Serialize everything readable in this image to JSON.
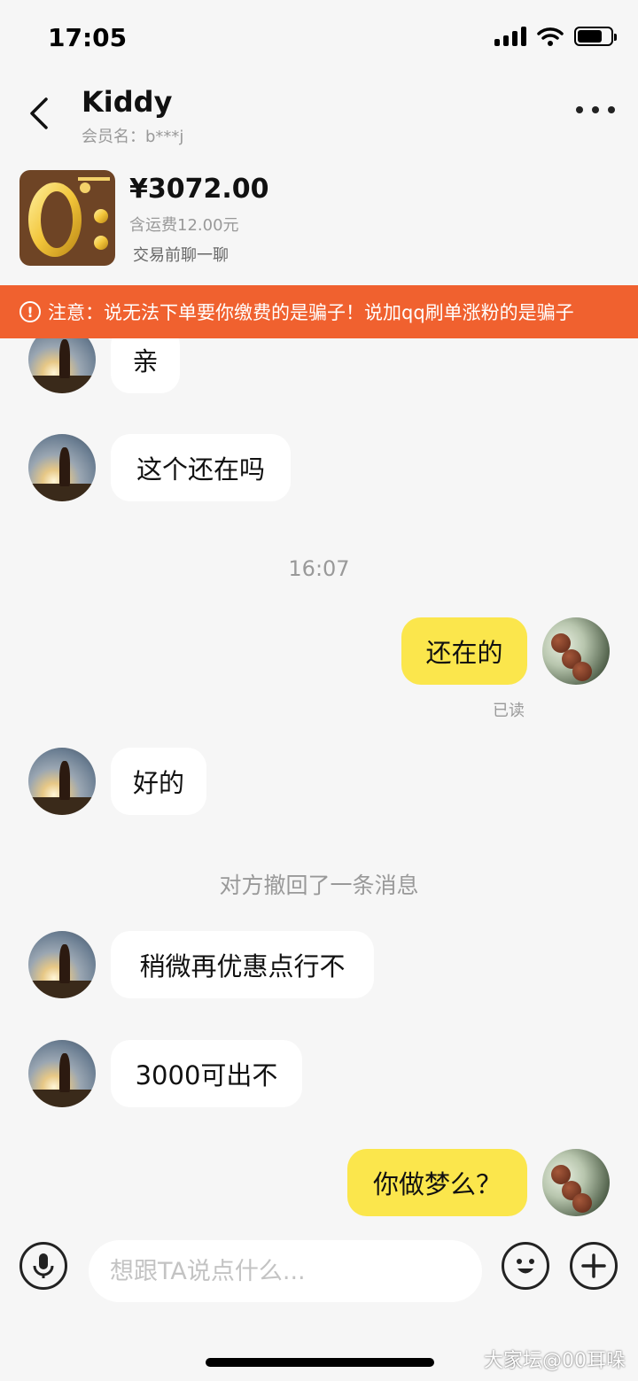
{
  "status_bar": {
    "time": "17:05"
  },
  "header": {
    "title": "Kiddy",
    "member_name": "会员名：b***j"
  },
  "product": {
    "price": "¥3072.00",
    "shipping": "含运费12.00元",
    "chat_label": "交易前聊一聊"
  },
  "warning": {
    "text": "注意：说无法下单要你缴费的是骗子！说加qq刷单涨粉的是骗子"
  },
  "messages": {
    "m1": "亲",
    "m2": "这个还在吗",
    "time1": "16:07",
    "m3": "还在的",
    "read1": "已读",
    "m4": "好的",
    "recall": "对方撤回了一条消息",
    "m5": "稍微再优惠点行不",
    "m6": "3000可出不",
    "m7": "你做梦么？"
  },
  "input": {
    "placeholder": "想跟TA说点什么..."
  },
  "watermark": "大家坛@00耳哚"
}
